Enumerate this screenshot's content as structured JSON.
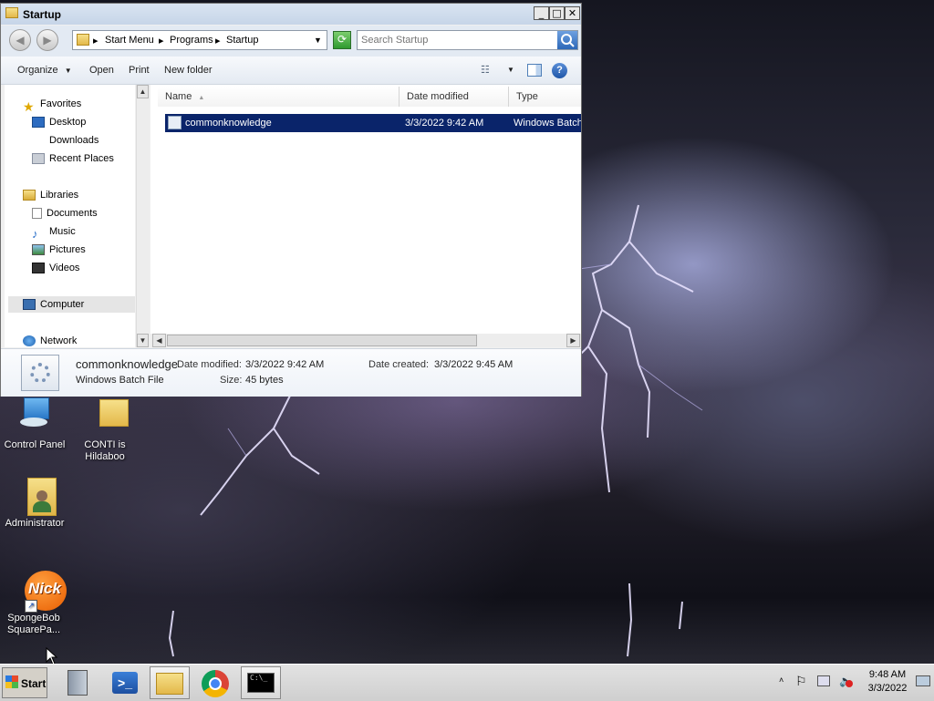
{
  "window": {
    "title": "Startup",
    "breadcrumbs": [
      "Start Menu",
      "Programs",
      "Startup"
    ],
    "search_placeholder": "Search Startup",
    "toolbar": {
      "organize": "Organize",
      "open": "Open",
      "print": "Print",
      "new_folder": "New folder"
    },
    "nav": {
      "favorites": "Favorites",
      "desktop": "Desktop",
      "downloads": "Downloads",
      "recent_places": "Recent Places",
      "libraries": "Libraries",
      "documents": "Documents",
      "music": "Music",
      "pictures": "Pictures",
      "videos": "Videos",
      "computer": "Computer",
      "network": "Network"
    },
    "columns": {
      "name": "Name",
      "date_modified": "Date modified",
      "type": "Type"
    },
    "files": [
      {
        "name": "commonknowledge",
        "date_modified": "3/3/2022 9:42 AM",
        "type": "Windows Batch"
      }
    ],
    "details": {
      "name": "commonknowledge",
      "type": "Windows Batch File",
      "date_modified_label": "Date modified:",
      "date_modified": "3/3/2022 9:42 AM",
      "date_created_label": "Date created:",
      "date_created": "3/3/2022 9:45 AM",
      "size_label": "Size:",
      "size": "45 bytes"
    }
  },
  "desktop": {
    "icons": {
      "control_panel": "Control Panel",
      "conti": "CONTI is Hildaboo",
      "administrator": "Administrator",
      "spongebob": "SpongeBob SquarePa..."
    }
  },
  "taskbar": {
    "start": "Start",
    "time": "9:48 AM",
    "date": "3/3/2022"
  },
  "colors": {
    "selection": "#0a246a",
    "title_bar": "#c6d5e8",
    "taskbar": "#d6d6d6"
  }
}
